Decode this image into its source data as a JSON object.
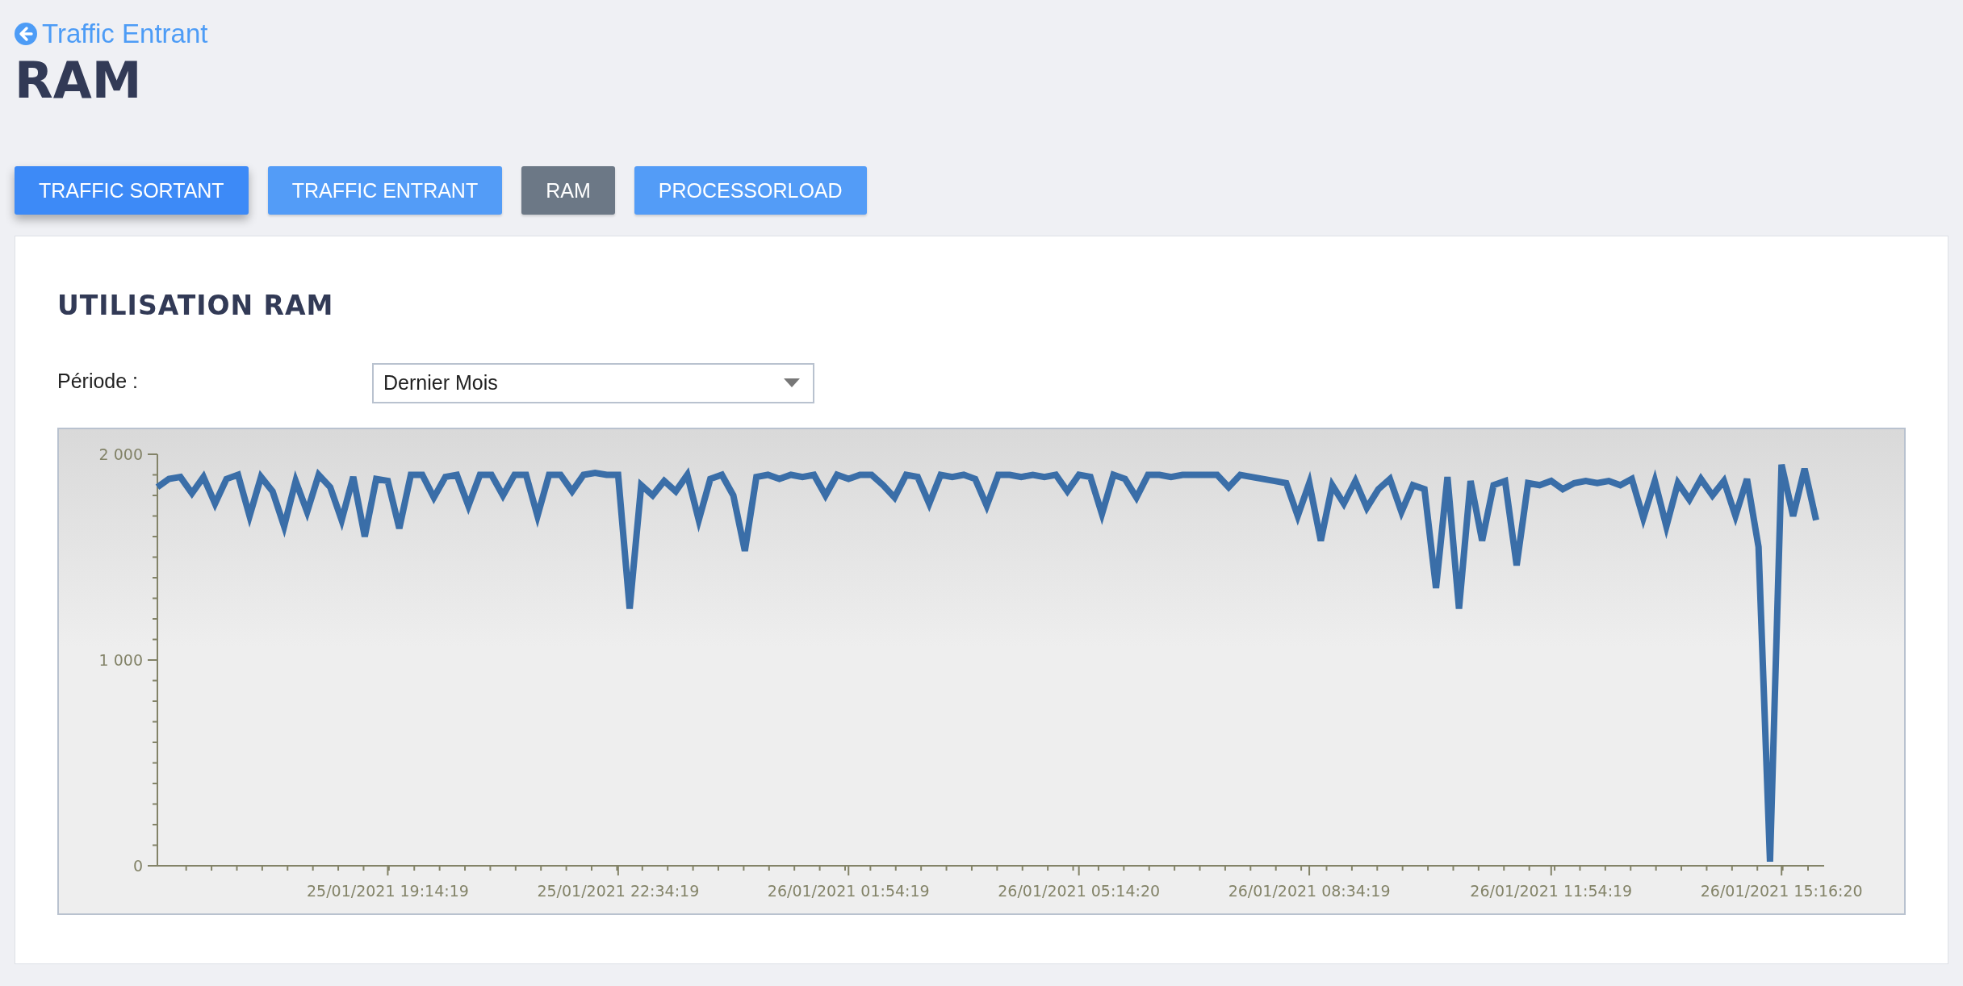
{
  "back_link": {
    "label": "Traffic Entrant"
  },
  "page_title": "RAM",
  "tabs": [
    {
      "label": "TRAFFIC SORTANT",
      "selected": false,
      "focused": true
    },
    {
      "label": "TRAFFIC ENTRANT",
      "selected": false,
      "focused": false
    },
    {
      "label": "RAM",
      "selected": true,
      "focused": false
    },
    {
      "label": "PROCESSORLOAD",
      "selected": false,
      "focused": false
    }
  ],
  "panel": {
    "title": "UTILISATION RAM",
    "period_label": "Période :",
    "period_value": "Dernier Mois",
    "chart_data": {
      "type": "line",
      "ylim": [
        0,
        2000
      ],
      "yticks": [
        {
          "value": 0,
          "label": "0"
        },
        {
          "value": 1000,
          "label": "1 000"
        },
        {
          "value": 2000,
          "label": "2 000"
        }
      ],
      "categories": [
        null,
        null,
        null,
        null,
        null,
        null,
        null,
        null,
        null,
        null,
        null,
        null,
        null,
        null,
        null,
        null,
        null,
        null,
        null,
        null,
        "25/01/2021 19:14:19",
        null,
        null,
        null,
        null,
        null,
        null,
        null,
        null,
        null,
        null,
        null,
        null,
        null,
        null,
        null,
        null,
        null,
        null,
        null,
        "25/01/2021 22:34:19",
        null,
        null,
        null,
        null,
        null,
        null,
        null,
        null,
        null,
        null,
        null,
        null,
        null,
        null,
        null,
        null,
        null,
        null,
        null,
        "26/01/2021 01:54:19",
        null,
        null,
        null,
        null,
        null,
        null,
        null,
        null,
        null,
        null,
        null,
        null,
        null,
        null,
        null,
        null,
        null,
        null,
        null,
        "26/01/2021 05:14:20",
        null,
        null,
        null,
        null,
        null,
        null,
        null,
        null,
        null,
        null,
        null,
        null,
        null,
        null,
        null,
        null,
        null,
        null,
        null,
        "26/01/2021 08:34:19",
        null,
        null,
        null,
        null,
        null,
        null,
        null,
        null,
        null,
        null,
        null,
        null,
        null,
        null,
        null,
        null,
        null,
        null,
        null,
        null,
        "26/01/2021 11:54:19",
        null,
        null,
        null,
        null,
        null,
        null,
        null,
        null,
        null,
        null,
        null,
        null,
        null,
        null,
        null,
        null,
        null,
        null,
        null,
        "26/01/2021 15:16:20",
        null,
        null,
        null
      ],
      "series": [
        {
          "color": "#3a6ea8",
          "values": [
            1840,
            1880,
            1890,
            1810,
            1890,
            1760,
            1880,
            1900,
            1700,
            1890,
            1820,
            1650,
            1870,
            1720,
            1900,
            1840,
            1680,
            1890,
            1600,
            1880,
            1870,
            1640,
            1900,
            1900,
            1790,
            1890,
            1900,
            1750,
            1900,
            1900,
            1800,
            1900,
            1900,
            1700,
            1900,
            1900,
            1820,
            1900,
            1910,
            1900,
            1900,
            1250,
            1850,
            1800,
            1870,
            1820,
            1900,
            1680,
            1880,
            1900,
            1800,
            1530,
            1890,
            1900,
            1880,
            1900,
            1890,
            1900,
            1800,
            1900,
            1880,
            1900,
            1900,
            1850,
            1790,
            1900,
            1890,
            1760,
            1900,
            1890,
            1900,
            1880,
            1750,
            1900,
            1900,
            1890,
            1900,
            1890,
            1900,
            1820,
            1900,
            1890,
            1710,
            1900,
            1880,
            1790,
            1900,
            1900,
            1890,
            1900,
            1900,
            1900,
            1900,
            1840,
            1900,
            1890,
            1880,
            1870,
            1860,
            1700,
            1860,
            1580,
            1850,
            1760,
            1870,
            1740,
            1830,
            1880,
            1720,
            1850,
            1830,
            1350,
            1890,
            1250,
            1870,
            1580,
            1850,
            1870,
            1460,
            1860,
            1850,
            1870,
            1830,
            1860,
            1870,
            1860,
            1870,
            1850,
            1880,
            1690,
            1870,
            1650,
            1860,
            1780,
            1880,
            1800,
            1870,
            1700,
            1880,
            1550,
            20,
            1950,
            1700,
            1930,
            1680
          ]
        }
      ]
    }
  }
}
